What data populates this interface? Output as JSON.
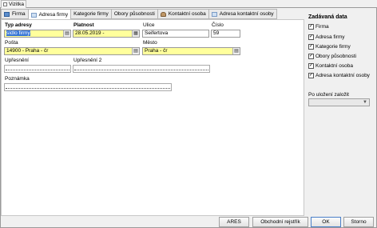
{
  "window": {
    "title": "Vizitka"
  },
  "tabs": [
    {
      "label": "Firma",
      "icon": "document-icon"
    },
    {
      "label": "Adresa firmy",
      "icon": "envelope-icon"
    },
    {
      "label": "Kategorie firmy",
      "icon": ""
    },
    {
      "label": "Obory působnosti",
      "icon": ""
    },
    {
      "label": "Kontaktní osoba",
      "icon": "person-icon"
    },
    {
      "label": "Adresa kontaktní osoby",
      "icon": "envelope-icon"
    }
  ],
  "form": {
    "typ_adresy": {
      "label": "Typ adresy",
      "value": "sídlo firmy"
    },
    "platnost": {
      "label": "Platnost",
      "value": "28.05.2019 -"
    },
    "ulice": {
      "label": "Ulice",
      "value": "Seifertova"
    },
    "cislo": {
      "label": "Číslo",
      "value": "59"
    },
    "posta": {
      "label": "Pošta",
      "value": "14900 - Praha - čr"
    },
    "mesto": {
      "label": "Město",
      "value": "Praha - čr"
    },
    "upresneni": {
      "label": "Upřesnění",
      "value": ""
    },
    "upresneni2": {
      "label": "Upřesnění 2",
      "value": ""
    },
    "poznamka": {
      "label": "Poznámka",
      "value": ""
    }
  },
  "sidebar": {
    "title": "Zadávaná data",
    "items": [
      {
        "label": "Firma",
        "checked": true
      },
      {
        "label": "Adresa firmy",
        "checked": true
      },
      {
        "label": "Kategorie firmy",
        "checked": true
      },
      {
        "label": "Obory působnosti",
        "checked": true
      },
      {
        "label": "Kontaktní osoba",
        "checked": true
      },
      {
        "label": "Adresa kontaktní osoby",
        "checked": true
      }
    ],
    "after_save_label": "Po uložení založit",
    "after_save_value": ""
  },
  "buttons": {
    "ares": "ARES",
    "obchodni_rejstrik": "Obchodní rejstřík",
    "ok": "OK",
    "storno": "Storno"
  }
}
